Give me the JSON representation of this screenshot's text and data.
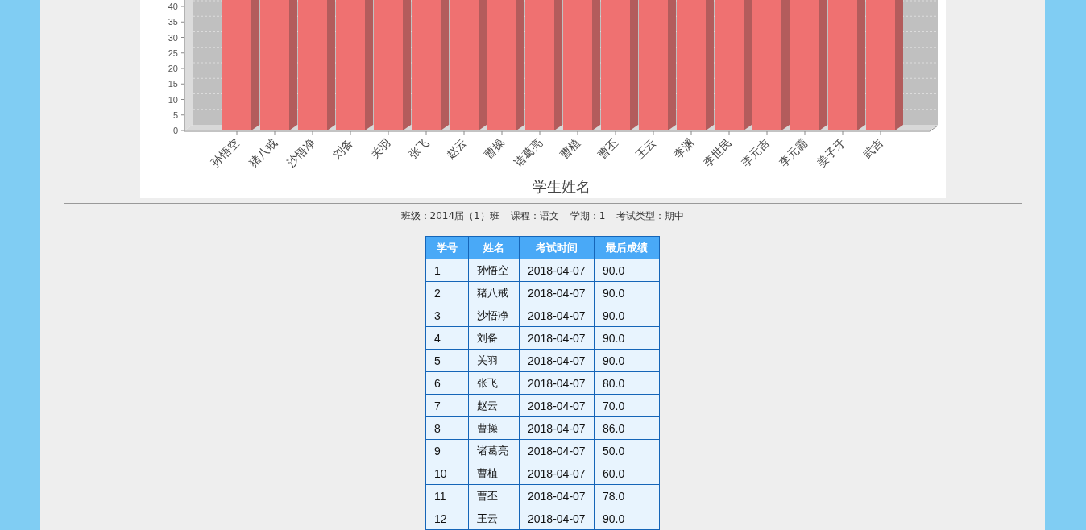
{
  "chart": {
    "yticks": [
      "40",
      "35",
      "30",
      "25",
      "20",
      "15",
      "10",
      "5",
      "0"
    ],
    "categories": [
      "孙悟空",
      "猪八戒",
      "沙悟净",
      "刘备",
      "关羽",
      "张飞",
      "赵云",
      "曹操",
      "诸葛亮",
      "曹植",
      "曹丕",
      "王云",
      "李渊",
      "李世民",
      "李元吉",
      "李元霸",
      "姜子牙",
      "武吉"
    ],
    "xlabel": "学生姓名"
  },
  "info": [
    "班级：2014届（1）班",
    "课程：语文",
    "学期：1",
    "考试类型：期中"
  ],
  "table": {
    "columns": [
      "学号",
      "姓名",
      "考试时间",
      "最后成绩"
    ],
    "rows": [
      [
        "1",
        "孙悟空",
        "2018-04-07",
        "90.0"
      ],
      [
        "2",
        "猪八戒",
        "2018-04-07",
        "90.0"
      ],
      [
        "3",
        "沙悟净",
        "2018-04-07",
        "90.0"
      ],
      [
        "4",
        "刘备",
        "2018-04-07",
        "90.0"
      ],
      [
        "5",
        "关羽",
        "2018-04-07",
        "90.0"
      ],
      [
        "6",
        "张飞",
        "2018-04-07",
        "80.0"
      ],
      [
        "7",
        "赵云",
        "2018-04-07",
        "70.0"
      ],
      [
        "8",
        "曹操",
        "2018-04-07",
        "86.0"
      ],
      [
        "9",
        "诸葛亮",
        "2018-04-07",
        "50.0"
      ],
      [
        "10",
        "曹植",
        "2018-04-07",
        "60.0"
      ],
      [
        "11",
        "曹丕",
        "2018-04-07",
        "78.0"
      ],
      [
        "12",
        "王云",
        "2018-04-07",
        "90.0"
      ]
    ]
  }
}
